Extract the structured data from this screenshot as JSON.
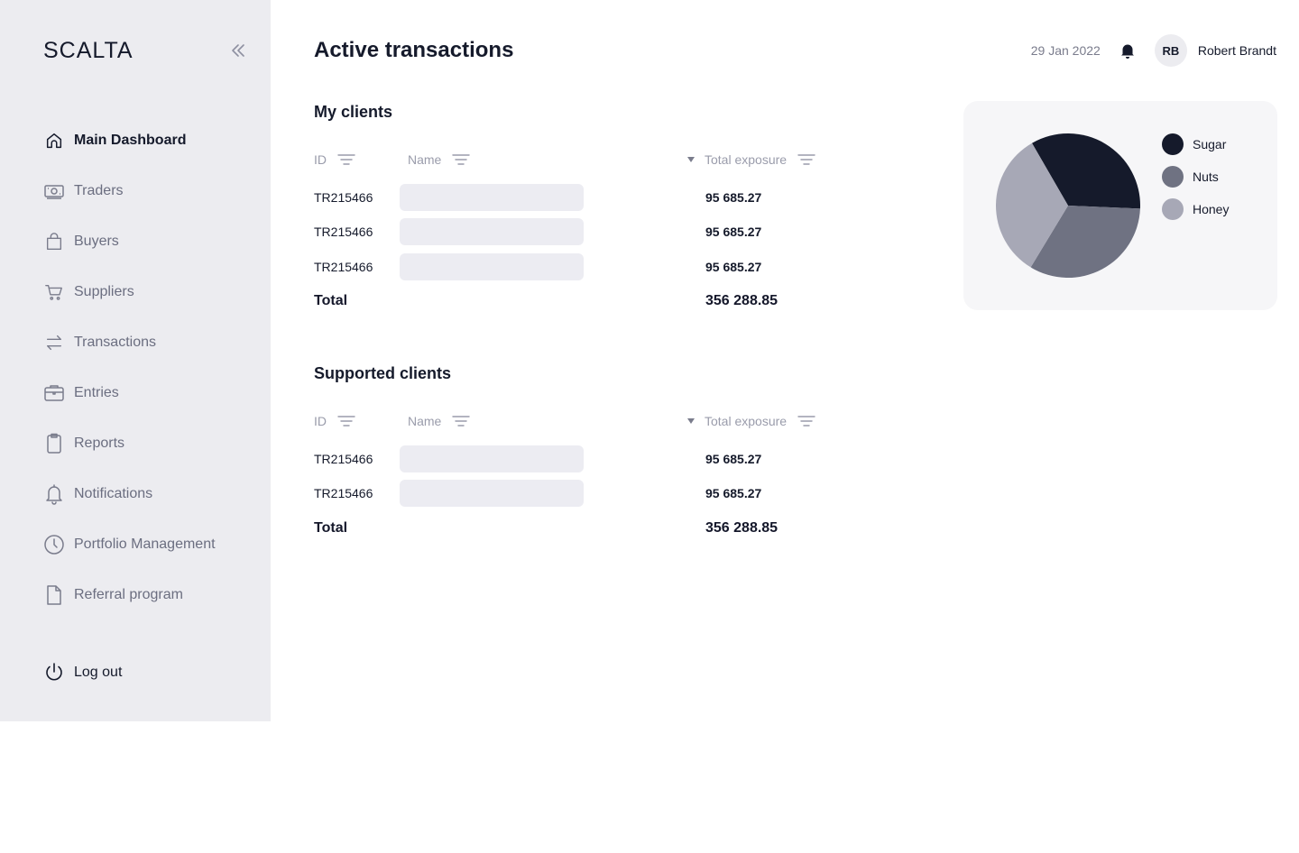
{
  "app": {
    "logo": "SCALTA"
  },
  "sidebar": {
    "items": [
      {
        "label": "Main Dashboard",
        "icon": "home-icon",
        "active": true
      },
      {
        "label": "Traders",
        "icon": "money-icon"
      },
      {
        "label": "Buyers",
        "icon": "shopping-bag-icon"
      },
      {
        "label": "Suppliers",
        "icon": "cart-icon"
      },
      {
        "label": "Transactions",
        "icon": "arrows-swap-icon"
      },
      {
        "label": "Entries",
        "icon": "briefcase-icon"
      },
      {
        "label": "Reports",
        "icon": "clipboard-icon"
      },
      {
        "label": "Notifications",
        "icon": "bell-icon"
      },
      {
        "label": "Portfolio Management",
        "icon": "clock-icon"
      },
      {
        "label": "Referral program",
        "icon": "file-icon"
      }
    ],
    "logout": "Log out"
  },
  "header": {
    "title": "Active transactions",
    "date": "29 Jan 2022",
    "user_initials": "RB",
    "user_name": "Robert Brandt"
  },
  "my_clients": {
    "title": "My clients",
    "columns": {
      "id": "ID",
      "name": "Name",
      "exposure": "Total exposure"
    },
    "rows": [
      {
        "id": "TR215466",
        "value": "95 685.27"
      },
      {
        "id": "TR215466",
        "value": "95 685.27"
      },
      {
        "id": "TR215466",
        "value": "95 685.27"
      }
    ],
    "total_label": "Total",
    "total_value": "356 288.85"
  },
  "supported_clients": {
    "title": "Supported clients",
    "columns": {
      "id": "ID",
      "name": "Name",
      "exposure": "Total exposure"
    },
    "rows": [
      {
        "id": "TR215466",
        "value": "95 685.27"
      },
      {
        "id": "TR215466",
        "value": "95 685.27"
      }
    ],
    "total_label": "Total",
    "total_value": "356 288.85"
  },
  "chart_data": {
    "type": "pie",
    "categories": [
      "Sugar",
      "Nuts",
      "Honey"
    ],
    "values": [
      34,
      33,
      33
    ],
    "colors": [
      "#151a2b",
      "#6f7282",
      "#a7a8b6"
    ]
  }
}
